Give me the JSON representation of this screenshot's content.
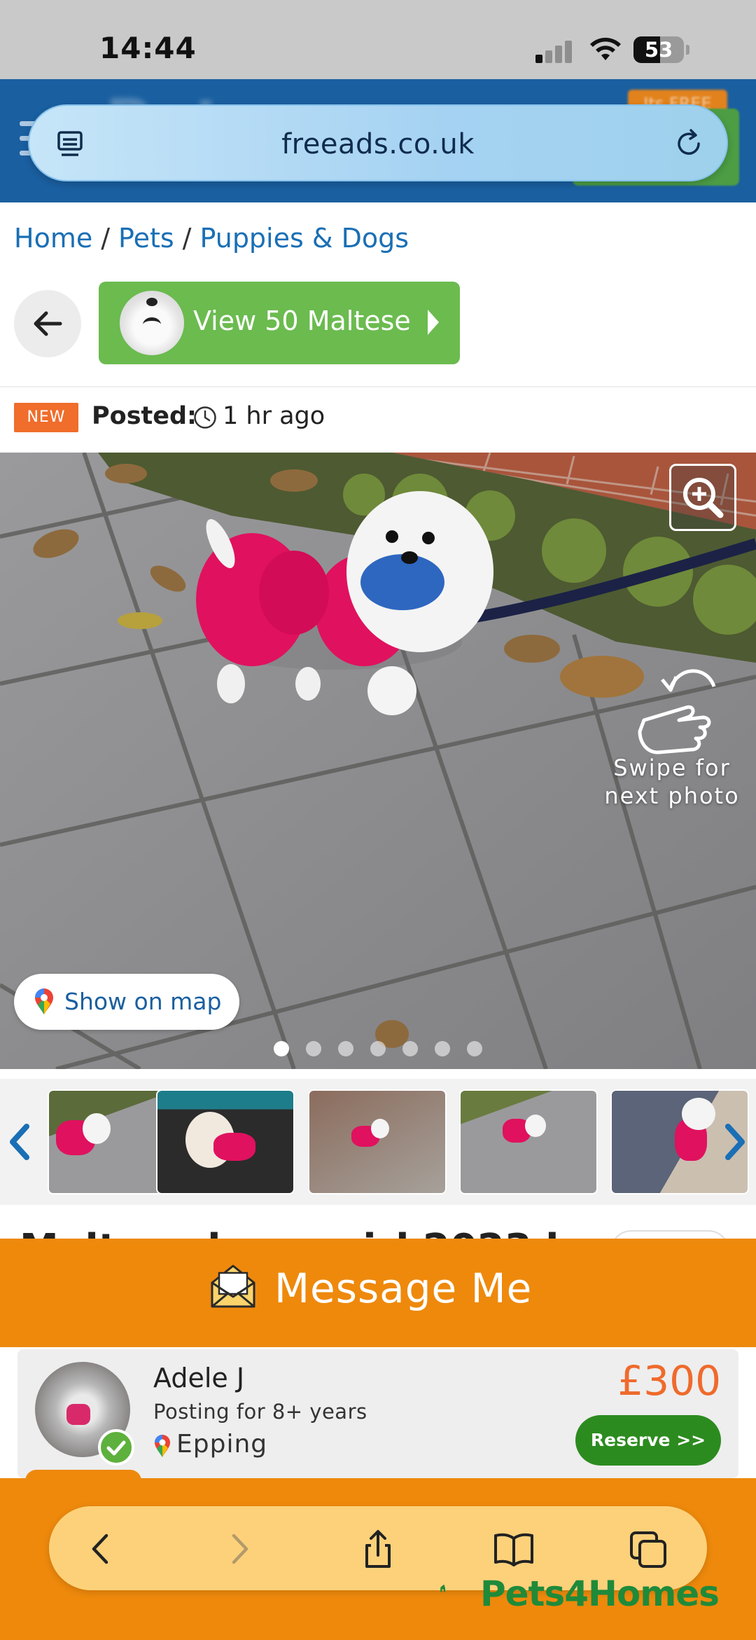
{
  "status_bar": {
    "time": "14:44",
    "battery": "53",
    "battery_level": 0.53
  },
  "browser": {
    "url": "freeads.co.uk"
  },
  "header": {
    "badge": "Its FREE"
  },
  "breadcrumb": {
    "items": [
      "Home",
      "Pets",
      "Puppies & Dogs"
    ],
    "separator": "/"
  },
  "view_button": {
    "label": "View 50 Maltese"
  },
  "posted": {
    "badge": "NEW",
    "label": "Posted:",
    "time": "1 hr ago"
  },
  "photo": {
    "swipe_hint_line1": "Swipe for",
    "swipe_hint_line2": "next photo",
    "map_button": "Show on map",
    "total_photos": 7,
    "active_index": 0
  },
  "thumbnails": {
    "count": 5
  },
  "title_peek": "Maltese boy – girl 2023 k",
  "message": {
    "label": "Message Me"
  },
  "seller": {
    "name": "Adele J",
    "tenure": "Posting for 8+ years",
    "location": "Epping",
    "price": "£300",
    "reserve_label": "Reserve >>"
  },
  "footer": {
    "brand": "Pets4Homes"
  },
  "colors": {
    "header_blue": "#1a5fa0",
    "green": "#6bbb4f",
    "orange": "#ee890c",
    "price": "#ef6a2c",
    "reserve": "#2c8b1f"
  }
}
